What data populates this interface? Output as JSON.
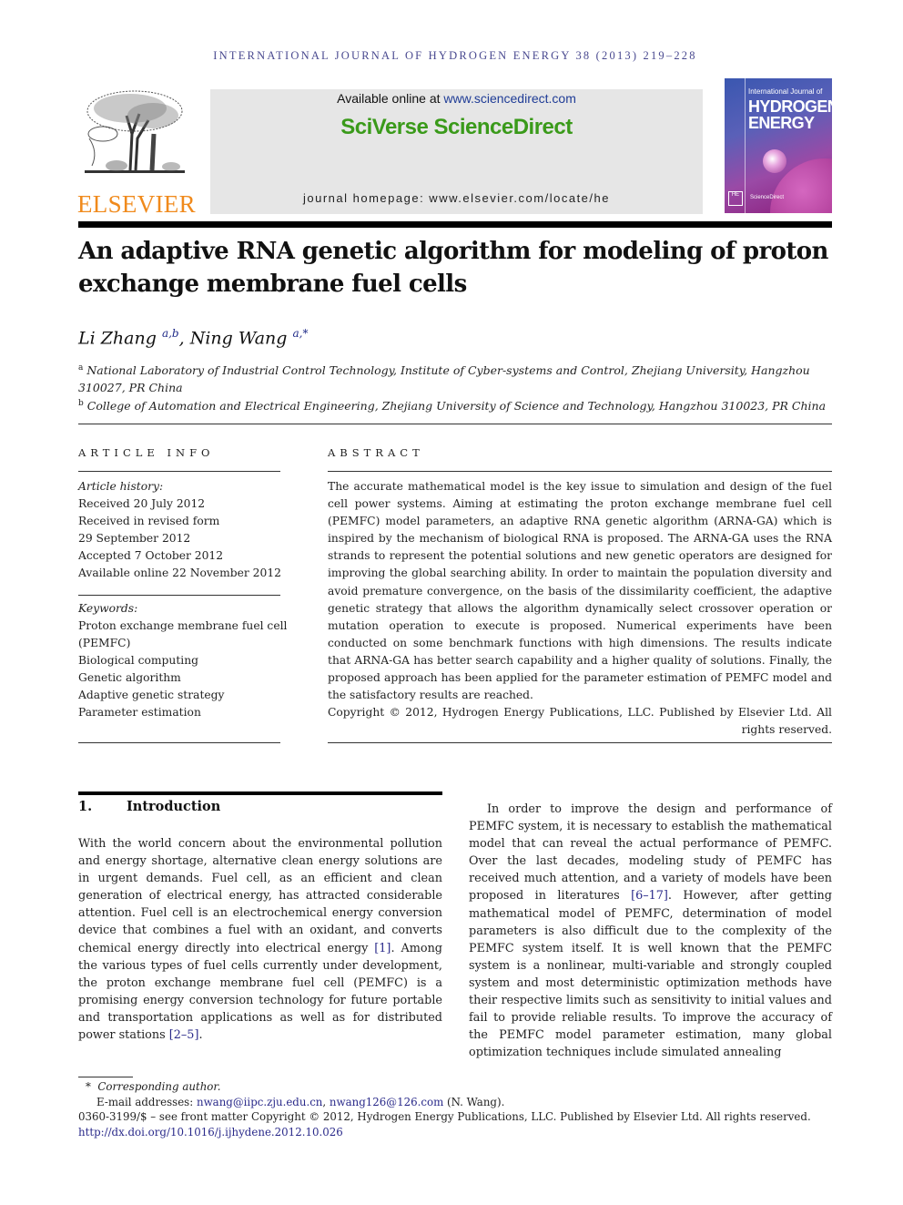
{
  "running_head": "INTERNATIONAL JOURNAL OF HYDROGEN ENERGY 38 (2013) 219–228",
  "header": {
    "publisher_logo_text": "ELSEVIER",
    "available_online_prefix": "Available online at ",
    "available_online_link": "www.sciencedirect.com",
    "platform_name": "SciVerse ScienceDirect",
    "journal_homepage": "journal homepage: www.elsevier.com/locate/he",
    "cover": {
      "line1": "International Journal of",
      "line2": "HYDROGEN",
      "line3": "ENERGY",
      "badge": "HE",
      "footer": "ScienceDirect"
    },
    "colors": {
      "elsevier_orange": "#f08a1c",
      "sciverse_green": "#3a9a1a",
      "link_blue": "#2a2a8a",
      "banner_gray": "#e6e6e6"
    }
  },
  "article": {
    "title": "An adaptive RNA genetic algorithm for modeling of proton exchange membrane fuel cells",
    "authors": [
      {
        "name": "Li Zhang",
        "marks": "a,b"
      },
      {
        "name": "Ning Wang",
        "marks": "a,*"
      }
    ],
    "author_separator": ", ",
    "affiliations": [
      {
        "mark": "a",
        "text": "National Laboratory of Industrial Control Technology, Institute of Cyber-systems and Control, Zhejiang University, Hangzhou 310027, PR China"
      },
      {
        "mark": "b",
        "text": "College of Automation and Electrical Engineering, Zhejiang University of Science and Technology, Hangzhou 310023, PR China"
      }
    ]
  },
  "article_info": {
    "label": "ARTICLE INFO",
    "history_heading": "Article history:",
    "history": [
      "Received 20 July 2012",
      "Received in revised form",
      "29 September 2012",
      "Accepted 7 October 2012",
      "Available online 22 November 2012"
    ],
    "keywords_heading": "Keywords:",
    "keywords": [
      "Proton exchange membrane fuel cell",
      "(PEMFC)",
      "Biological computing",
      "Genetic algorithm",
      "Adaptive genetic strategy",
      "Parameter estimation"
    ]
  },
  "abstract": {
    "label": "ABSTRACT",
    "text": "The accurate mathematical model is the key issue to simulation and design of the fuel cell power systems. Aiming at estimating the proton exchange membrane fuel cell (PEMFC) model parameters, an adaptive RNA genetic algorithm (ARNA-GA) which is inspired by the mechanism of biological RNA is proposed. The ARNA-GA uses the RNA strands to represent the potential solutions and new genetic operators are designed for improving the global searching ability. In order to maintain the population diversity and avoid premature convergence, on the basis of the dissimilarity coefficient, the adaptive genetic strategy that allows the algorithm dynamically select crossover operation or mutation operation to execute is proposed. Numerical experiments have been conducted on some benchmark functions with high dimensions. The results indicate that ARNA-GA has better search capability and a higher quality of solutions. Finally, the proposed approach has been applied for the parameter estimation of PEMFC model and the satisfactory results are reached.",
    "copyright": "Copyright © 2012, Hydrogen Energy Publications, LLC. Published by Elsevier Ltd. All rights reserved."
  },
  "section1": {
    "number": "1.",
    "title": "Introduction",
    "left_para": {
      "t1": "With the world concern about the environmental pollution and energy shortage, alternative clean energy solutions are in urgent demands. Fuel cell, as an efficient and clean generation of electrical energy, has attracted considerable attention. Fuel cell is an electrochemical energy conversion device that combines a fuel with an oxidant, and converts chemical energy directly into electrical energy ",
      "ref1": "[1]",
      "t2": ". Among the various types of fuel cells currently under development, the proton exchange membrane fuel cell (PEMFC) is a promising energy conversion technology for future portable and transportation applications as well as for distributed power stations ",
      "ref2": "[2–5]",
      "t3": "."
    },
    "right_para": {
      "t1": "In order to improve the design and performance of PEMFC system, it is necessary to establish the mathematical model that can reveal the actual performance of PEMFC. Over the last decades, modeling study of PEMFC has received much attention, and a variety of models have been proposed in literatures ",
      "ref1": "[6–17]",
      "t2": ". However, after getting mathematical model of PEMFC, determination of model parameters is also difficult due to the complexity of the PEMFC system itself. It is well known that the PEMFC system is a nonlinear, multi-variable and strongly coupled system and most deterministic optimization methods have their respective limits such as sensitivity to initial values and fail to provide reliable results. To improve the accuracy of the PEMFC model parameter estimation, many global optimization techniques include simulated annealing"
    }
  },
  "footnotes": {
    "corresponding_mark": "*",
    "corresponding_text": "Corresponding author.",
    "email_label": "E-mail addresses: ",
    "email1": "nwang@iipc.zju.edu.cn",
    "email_sep": ", ",
    "email2": "nwang126@126.com",
    "email_owner": " (N. Wang).",
    "issn_line": "0360-3199/$ – see front matter Copyright © 2012, Hydrogen Energy Publications, LLC. Published by Elsevier Ltd. All rights reserved.",
    "doi": "http://dx.doi.org/10.1016/j.ijhydene.2012.10.026"
  }
}
